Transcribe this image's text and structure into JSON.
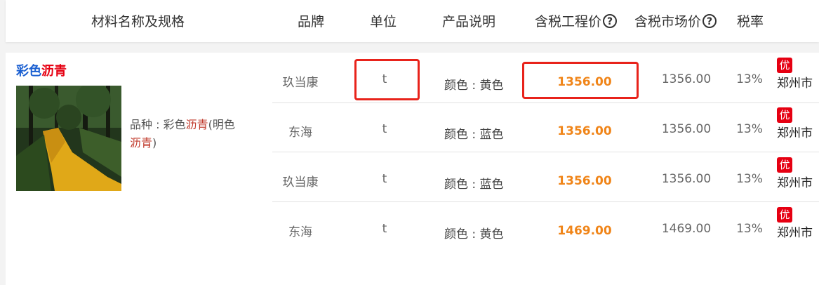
{
  "header": {
    "col_material": "材料名称及规格",
    "col_brand": "品牌",
    "col_unit": "单位",
    "col_desc": "产品说明",
    "col_eng_price": "含税工程价",
    "col_market_price": "含税市场价",
    "col_tax": "税率",
    "help_glyph": "?"
  },
  "material": {
    "title_part1": "彩色",
    "title_part2": "沥青",
    "spec_label": "品种 : 彩色",
    "spec_hl1": "沥青",
    "spec_mid": "(明色",
    "spec_hl2": "沥青",
    "spec_end": ")"
  },
  "rows": [
    {
      "brand": "玖当康",
      "unit": "t",
      "desc": "颜色 : 黄色",
      "eng_price": "1356.00",
      "market_price": "1356.00",
      "tax": "13%",
      "badge": "优",
      "city": "郑州市"
    },
    {
      "brand": "东海",
      "unit": "t",
      "desc": "颜色 : 蓝色",
      "eng_price": "1356.00",
      "market_price": "1356.00",
      "tax": "13%",
      "badge": "优",
      "city": "郑州市"
    },
    {
      "brand": "玖当康",
      "unit": "t",
      "desc": "颜色 : 蓝色",
      "eng_price": "1356.00",
      "market_price": "1356.00",
      "tax": "13%",
      "badge": "优",
      "city": "郑州市"
    },
    {
      "brand": "东海",
      "unit": "t",
      "desc": "颜色 : 黄色",
      "eng_price": "1469.00",
      "market_price": "1469.00",
      "tax": "13%",
      "badge": "优",
      "city": "郑州市"
    }
  ],
  "colors": {
    "price_orange": "#f08519",
    "badge_red": "#e60012",
    "title_blue": "#1a5fd1",
    "highlight_box": "#e8231b"
  }
}
